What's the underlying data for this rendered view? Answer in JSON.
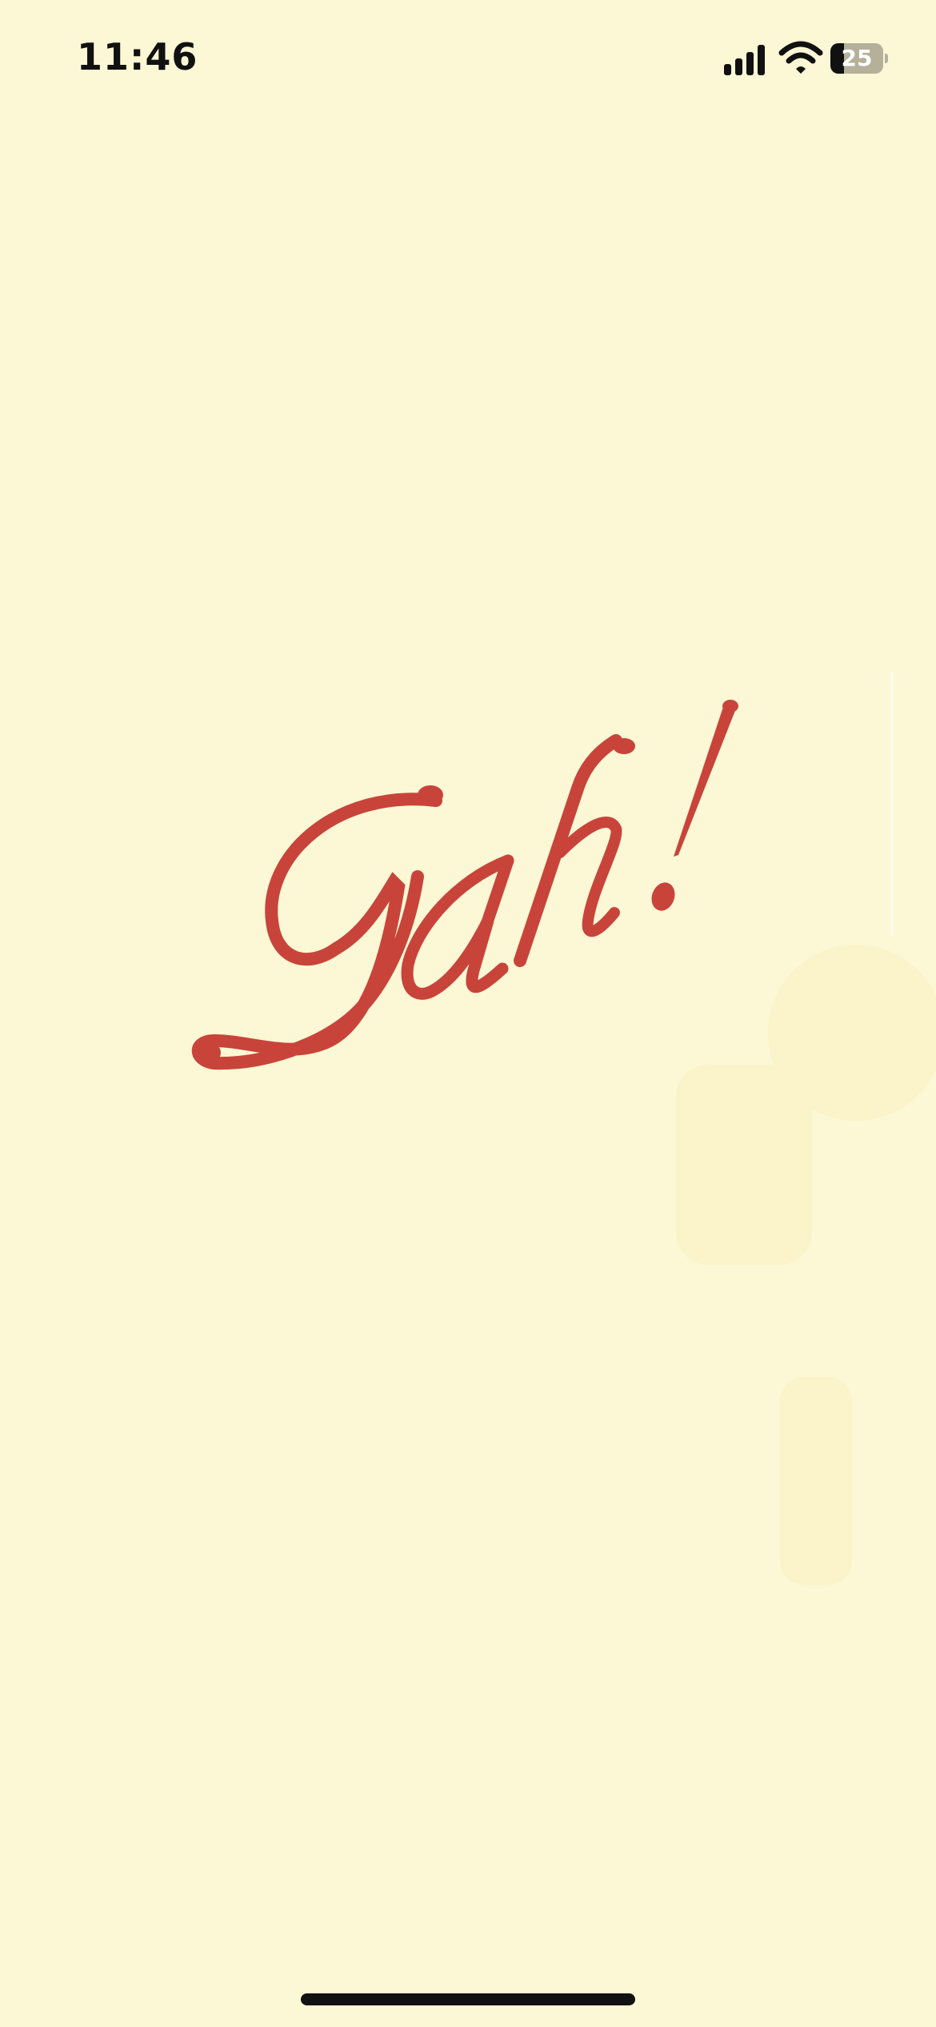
{
  "colors": {
    "background": "#fcf7d4",
    "logo": "#c8443a",
    "status_text": "#111111"
  },
  "status_bar": {
    "time": "11:46",
    "battery_level": "25",
    "icons": [
      "cellular-signal-icon",
      "wifi-icon",
      "battery-icon"
    ]
  },
  "logo": {
    "text": "Gah!"
  }
}
